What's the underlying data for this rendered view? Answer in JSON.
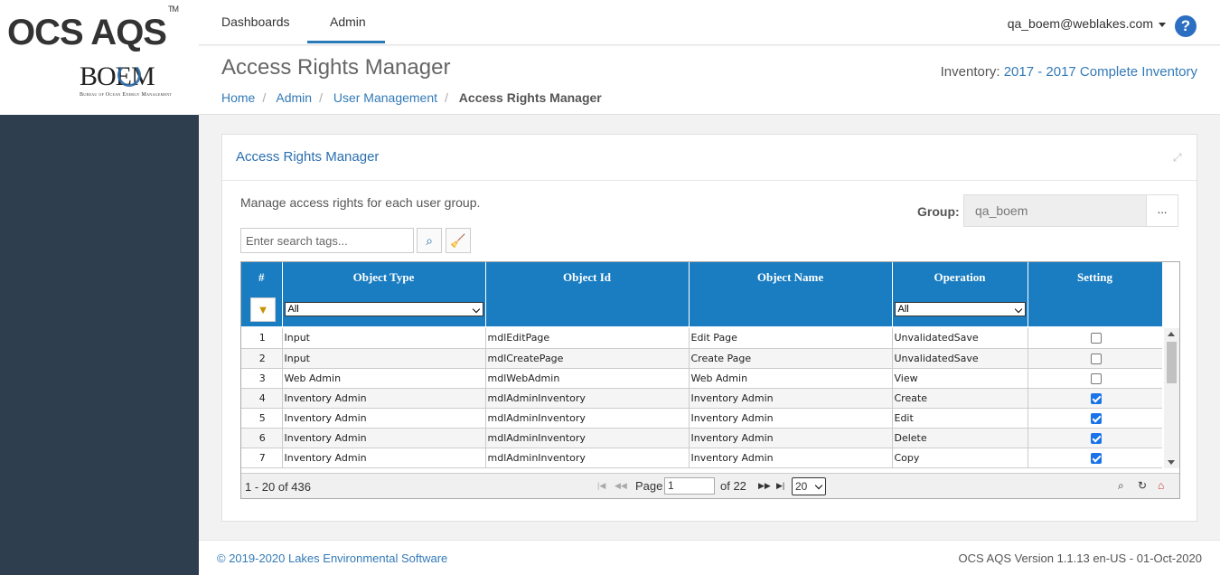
{
  "brand": {
    "product": "OCS AQS",
    "tm": "TM",
    "agency": "BOEM",
    "agency_full": "Bureau of Ocean Energy Management"
  },
  "nav": {
    "tabs": [
      "Dashboards",
      "Admin"
    ],
    "active": "Admin",
    "user": "qa_boem@weblakes.com",
    "help": "?"
  },
  "header": {
    "title": "Access Rights Manager",
    "breadcrumb": [
      "Home",
      "Admin",
      "User Management",
      "Access Rights Manager"
    ],
    "inventory_label": "Inventory:",
    "inventory_value": "2017 - 2017 Complete Inventory"
  },
  "panel": {
    "title": "Access Rights Manager",
    "intro": "Manage access rights for each user group.",
    "group_label": "Group:",
    "group_value": "qa_boem",
    "group_button": "...",
    "search_placeholder": "Enter search tags..."
  },
  "grid": {
    "columns": [
      "#",
      "Object Type",
      "Object Id",
      "Object Name",
      "Operation",
      "Setting"
    ],
    "filter_object_type": "All",
    "filter_operation": "All",
    "rows": [
      {
        "n": "1",
        "type": "Input",
        "id": "mdlEditPage",
        "name": "Edit Page",
        "op": "UnvalidatedSave",
        "setting": false
      },
      {
        "n": "2",
        "type": "Input",
        "id": "mdlCreatePage",
        "name": "Create Page",
        "op": "UnvalidatedSave",
        "setting": false
      },
      {
        "n": "3",
        "type": "Web Admin",
        "id": "mdlWebAdmin",
        "name": "Web Admin",
        "op": "View",
        "setting": false
      },
      {
        "n": "4",
        "type": "Inventory Admin",
        "id": "mdlAdminInventory",
        "name": "Inventory Admin",
        "op": "Create",
        "setting": true
      },
      {
        "n": "5",
        "type": "Inventory Admin",
        "id": "mdlAdminInventory",
        "name": "Inventory Admin",
        "op": "Edit",
        "setting": true
      },
      {
        "n": "6",
        "type": "Inventory Admin",
        "id": "mdlAdminInventory",
        "name": "Inventory Admin",
        "op": "Delete",
        "setting": true
      },
      {
        "n": "7",
        "type": "Inventory Admin",
        "id": "mdlAdminInventory",
        "name": "Inventory Admin",
        "op": "Copy",
        "setting": true
      }
    ],
    "pager": {
      "range": "1 - 20 of 436",
      "page_label": "Page",
      "page": "1",
      "of_total": "of 22",
      "page_size": "20"
    }
  },
  "footer": {
    "copyright": "© 2019-2020 Lakes Environmental Software",
    "version": "OCS AQS Version 1.1.13 en-US - 01-Oct-2020"
  },
  "colors": {
    "accent": "#1a7dc1",
    "link": "#337ab7",
    "sidebar": "#2f3e4e"
  }
}
